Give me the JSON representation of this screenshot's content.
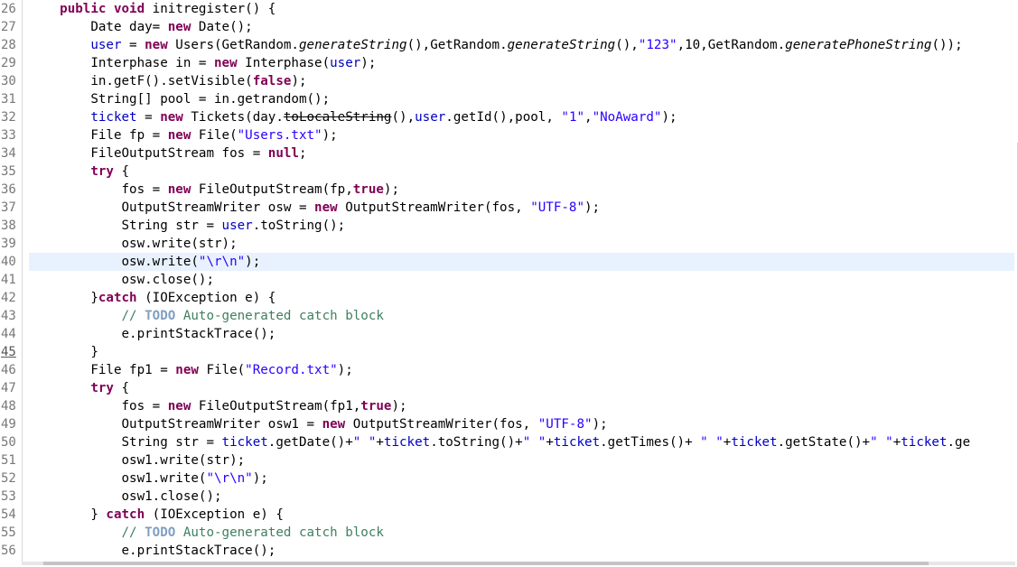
{
  "editor": {
    "current_line": 40,
    "lines": [
      {
        "n": "26",
        "tokens": [
          {
            "t": "    ",
            "c": ""
          },
          {
            "t": "public",
            "c": "kw"
          },
          {
            "t": " ",
            "c": ""
          },
          {
            "t": "void",
            "c": "kw"
          },
          {
            "t": " initregister() {",
            "c": ""
          }
        ]
      },
      {
        "n": "27",
        "tokens": [
          {
            "t": "        Date day= ",
            "c": ""
          },
          {
            "t": "new",
            "c": "kw"
          },
          {
            "t": " Date();",
            "c": ""
          }
        ]
      },
      {
        "n": "28",
        "tokens": [
          {
            "t": "        ",
            "c": ""
          },
          {
            "t": "user",
            "c": "field"
          },
          {
            "t": " = ",
            "c": ""
          },
          {
            "t": "new",
            "c": "kw"
          },
          {
            "t": " Users(GetRandom.",
            "c": ""
          },
          {
            "t": "generateString",
            "c": "static"
          },
          {
            "t": "(),GetRandom.",
            "c": ""
          },
          {
            "t": "generateString",
            "c": "static"
          },
          {
            "t": "(),",
            "c": ""
          },
          {
            "t": "\"123\"",
            "c": "str"
          },
          {
            "t": ",10,GetRandom.",
            "c": ""
          },
          {
            "t": "generatePhoneString",
            "c": "static"
          },
          {
            "t": "());",
            "c": ""
          }
        ]
      },
      {
        "n": "29",
        "tokens": [
          {
            "t": "        Interphase in = ",
            "c": ""
          },
          {
            "t": "new",
            "c": "kw"
          },
          {
            "t": " Interphase(",
            "c": ""
          },
          {
            "t": "user",
            "c": "field"
          },
          {
            "t": ");",
            "c": ""
          }
        ]
      },
      {
        "n": "30",
        "tokens": [
          {
            "t": "        in.getF().setVisible(",
            "c": ""
          },
          {
            "t": "false",
            "c": "kw"
          },
          {
            "t": ");",
            "c": ""
          }
        ]
      },
      {
        "n": "31",
        "tokens": [
          {
            "t": "        String[] pool = in.getrandom();",
            "c": ""
          }
        ]
      },
      {
        "n": "32",
        "tokens": [
          {
            "t": "        ",
            "c": ""
          },
          {
            "t": "ticket",
            "c": "field"
          },
          {
            "t": " = ",
            "c": ""
          },
          {
            "t": "new",
            "c": "kw"
          },
          {
            "t": " Tickets(day.",
            "c": ""
          },
          {
            "t": "toLocaleString",
            "c": "strike"
          },
          {
            "t": "(),",
            "c": ""
          },
          {
            "t": "user",
            "c": "field"
          },
          {
            "t": ".getId(),pool, ",
            "c": ""
          },
          {
            "t": "\"1\"",
            "c": "str"
          },
          {
            "t": ",",
            "c": ""
          },
          {
            "t": "\"NoAward\"",
            "c": "str"
          },
          {
            "t": ");",
            "c": ""
          }
        ]
      },
      {
        "n": "33",
        "tokens": [
          {
            "t": "        File fp = ",
            "c": ""
          },
          {
            "t": "new",
            "c": "kw"
          },
          {
            "t": " File(",
            "c": ""
          },
          {
            "t": "\"Users.txt\"",
            "c": "str"
          },
          {
            "t": ");",
            "c": ""
          }
        ]
      },
      {
        "n": "34",
        "tokens": [
          {
            "t": "        FileOutputStream fos = ",
            "c": ""
          },
          {
            "t": "null",
            "c": "kw"
          },
          {
            "t": ";",
            "c": ""
          }
        ]
      },
      {
        "n": "35",
        "tokens": [
          {
            "t": "        ",
            "c": ""
          },
          {
            "t": "try",
            "c": "kw"
          },
          {
            "t": " {",
            "c": ""
          }
        ]
      },
      {
        "n": "36",
        "tokens": [
          {
            "t": "            fos = ",
            "c": ""
          },
          {
            "t": "new",
            "c": "kw"
          },
          {
            "t": " FileOutputStream(fp,",
            "c": ""
          },
          {
            "t": "true",
            "c": "kw"
          },
          {
            "t": ");",
            "c": ""
          }
        ]
      },
      {
        "n": "37",
        "tokens": [
          {
            "t": "            OutputStreamWriter osw = ",
            "c": ""
          },
          {
            "t": "new",
            "c": "kw"
          },
          {
            "t": " OutputStreamWriter(fos, ",
            "c": ""
          },
          {
            "t": "\"UTF-8\"",
            "c": "str"
          },
          {
            "t": ");",
            "c": ""
          }
        ]
      },
      {
        "n": "38",
        "tokens": [
          {
            "t": "            String str = ",
            "c": ""
          },
          {
            "t": "user",
            "c": "field"
          },
          {
            "t": ".toString();",
            "c": ""
          }
        ]
      },
      {
        "n": "39",
        "tokens": [
          {
            "t": "            osw.write(str);",
            "c": ""
          }
        ]
      },
      {
        "n": "40",
        "tokens": [
          {
            "t": "            osw.write(",
            "c": ""
          },
          {
            "t": "\"\\r\\n\"",
            "c": "str"
          },
          {
            "t": ");",
            "c": ""
          }
        ]
      },
      {
        "n": "41",
        "tokens": [
          {
            "t": "            osw.close();",
            "c": ""
          }
        ]
      },
      {
        "n": "42",
        "tokens": [
          {
            "t": "        }",
            "c": ""
          },
          {
            "t": "catch",
            "c": "kw"
          },
          {
            "t": " (IOException e) {",
            "c": ""
          }
        ]
      },
      {
        "n": "43",
        "tokens": [
          {
            "t": "            // ",
            "c": "cmt"
          },
          {
            "t": "TODO",
            "c": "todo"
          },
          {
            "t": " Auto-generated catch block",
            "c": "cmt"
          }
        ]
      },
      {
        "n": "44",
        "tokens": [
          {
            "t": "            e.printStackTrace();",
            "c": ""
          }
        ]
      },
      {
        "n": "45",
        "tokens": [
          {
            "t": "        }",
            "c": ""
          }
        ]
      },
      {
        "n": "46",
        "tokens": [
          {
            "t": "        File fp1 = ",
            "c": ""
          },
          {
            "t": "new",
            "c": "kw"
          },
          {
            "t": " File(",
            "c": ""
          },
          {
            "t": "\"Record.txt\"",
            "c": "str"
          },
          {
            "t": ");",
            "c": ""
          }
        ]
      },
      {
        "n": "47",
        "tokens": [
          {
            "t": "        ",
            "c": ""
          },
          {
            "t": "try",
            "c": "kw"
          },
          {
            "t": " {",
            "c": ""
          }
        ]
      },
      {
        "n": "48",
        "tokens": [
          {
            "t": "            fos = ",
            "c": ""
          },
          {
            "t": "new",
            "c": "kw"
          },
          {
            "t": " FileOutputStream(fp1,",
            "c": ""
          },
          {
            "t": "true",
            "c": "kw"
          },
          {
            "t": ");",
            "c": ""
          }
        ]
      },
      {
        "n": "49",
        "tokens": [
          {
            "t": "            OutputStreamWriter osw1 = ",
            "c": ""
          },
          {
            "t": "new",
            "c": "kw"
          },
          {
            "t": " OutputStreamWriter(fos, ",
            "c": ""
          },
          {
            "t": "\"UTF-8\"",
            "c": "str"
          },
          {
            "t": ");",
            "c": ""
          }
        ]
      },
      {
        "n": "50",
        "tokens": [
          {
            "t": "            String str = ",
            "c": ""
          },
          {
            "t": "ticket",
            "c": "field"
          },
          {
            "t": ".getDate()+",
            "c": ""
          },
          {
            "t": "\" \"",
            "c": "str"
          },
          {
            "t": "+",
            "c": ""
          },
          {
            "t": "ticket",
            "c": "field"
          },
          {
            "t": ".toString()+",
            "c": ""
          },
          {
            "t": "\" \"",
            "c": "str"
          },
          {
            "t": "+",
            "c": ""
          },
          {
            "t": "ticket",
            "c": "field"
          },
          {
            "t": ".getTimes()+ ",
            "c": ""
          },
          {
            "t": "\" \"",
            "c": "str"
          },
          {
            "t": "+",
            "c": ""
          },
          {
            "t": "ticket",
            "c": "field"
          },
          {
            "t": ".getState()+",
            "c": ""
          },
          {
            "t": "\" \"",
            "c": "str"
          },
          {
            "t": "+",
            "c": ""
          },
          {
            "t": "ticket",
            "c": "field"
          },
          {
            "t": ".ge",
            "c": ""
          }
        ]
      },
      {
        "n": "51",
        "tokens": [
          {
            "t": "            osw1.write(str);",
            "c": ""
          }
        ]
      },
      {
        "n": "52",
        "tokens": [
          {
            "t": "            osw1.write(",
            "c": ""
          },
          {
            "t": "\"\\r\\n\"",
            "c": "str"
          },
          {
            "t": ");",
            "c": ""
          }
        ]
      },
      {
        "n": "53",
        "tokens": [
          {
            "t": "            osw1.close();",
            "c": ""
          }
        ]
      },
      {
        "n": "54",
        "tokens": [
          {
            "t": "        } ",
            "c": ""
          },
          {
            "t": "catch",
            "c": "kw"
          },
          {
            "t": " (IOException e) {",
            "c": ""
          }
        ]
      },
      {
        "n": "55",
        "tokens": [
          {
            "t": "            // ",
            "c": "cmt"
          },
          {
            "t": "TODO",
            "c": "todo"
          },
          {
            "t": " Auto-generated catch block",
            "c": "cmt"
          }
        ]
      },
      {
        "n": "56",
        "tokens": [
          {
            "t": "            e.printStackTrace();",
            "c": ""
          }
        ]
      }
    ]
  },
  "colors": {
    "keyword": "#7f0055",
    "field": "#0000c0",
    "string": "#2a00ff",
    "comment": "#3f7f5f",
    "todo": "#7f9fbf",
    "current_line_bg": "#e8f2fe"
  }
}
